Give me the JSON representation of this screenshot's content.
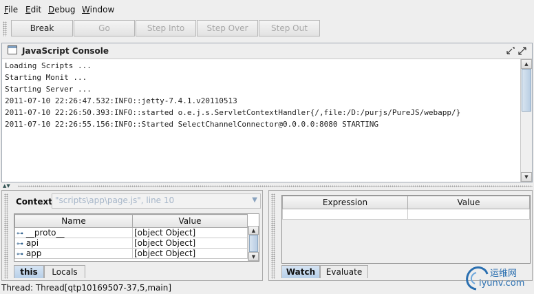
{
  "menu": [
    "File",
    "Edit",
    "Debug",
    "Window"
  ],
  "toolbar": {
    "buttons": [
      {
        "label": "Break",
        "enabled": true
      },
      {
        "label": "Go",
        "enabled": false
      },
      {
        "label": "Step Into",
        "enabled": false
      },
      {
        "label": "Step Over",
        "enabled": false
      },
      {
        "label": "Step Out",
        "enabled": false
      }
    ]
  },
  "console": {
    "title": "JavaScript Console",
    "lines": [
      "Loading Scripts ...",
      "Starting Monit ...",
      "Starting Server ...",
      "2011-07-10 22:26:47.532:INFO::jetty-7.4.1.v20110513",
      "2011-07-10 22:26:50.393:INFO::started o.e.j.s.ServletContextHandler{/,file:/D:/purjs/PureJS/webapp/}",
      "2011-07-10 22:26:55.156:INFO::Started SelectChannelConnector@0.0.0.0:8080 STARTING"
    ]
  },
  "context": {
    "label": "Context:",
    "value": "\"scripts\\app\\page.js\", line 10"
  },
  "vars_table": {
    "headers": [
      "Name",
      "Value"
    ],
    "rows": [
      {
        "name": "__proto__",
        "value": "[object Object]"
      },
      {
        "name": "api",
        "value": "[object Object]"
      },
      {
        "name": "app",
        "value": "[object Object]"
      }
    ]
  },
  "left_tabs": [
    "this",
    "Locals"
  ],
  "watch_table": {
    "headers": [
      "Expression",
      "Value"
    ]
  },
  "right_tabs": [
    "Watch",
    "Evaluate"
  ],
  "status": "Thread: Thread[qtp10169507-37,5,main]",
  "watermark": {
    "cn": "运维网",
    "url": "iyunv.com"
  },
  "colors": {
    "accent": "#b7cfe8",
    "watermark": "#2a6fb0"
  }
}
